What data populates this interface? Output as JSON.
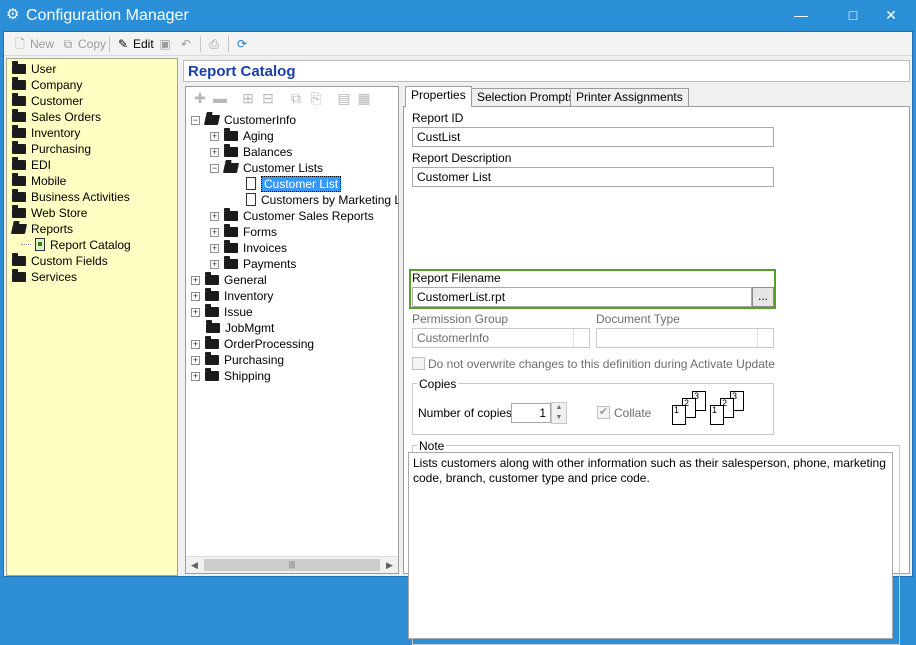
{
  "window": {
    "title": "Configuration Manager"
  },
  "toolbar": {
    "new": "New",
    "copy": "Copy",
    "edit": "Edit"
  },
  "nav": {
    "items": [
      "User",
      "Company",
      "Customer",
      "Sales Orders",
      "Inventory",
      "Purchasing",
      "EDI",
      "Mobile",
      "Business Activities",
      "Web Store",
      "Reports"
    ],
    "reports_child": "Report Catalog",
    "items_after": [
      "Custom Fields",
      "Services"
    ]
  },
  "catalog": {
    "title": "Report Catalog"
  },
  "tree": {
    "root": "CustomerInfo",
    "children": [
      "Aging",
      "Balances",
      "Customer Lists"
    ],
    "customer_lists_children": [
      "Customer List",
      "Customers by Marketing List"
    ],
    "more_children": [
      "Customer Sales Reports",
      "Forms",
      "Invoices",
      "Payments"
    ],
    "top_level": [
      "General",
      "Inventory",
      "Issue",
      "JobMgmt",
      "OrderProcessing",
      "Purchasing",
      "Shipping"
    ]
  },
  "tabs": [
    "Properties",
    "Selection Prompts",
    "Printer Assignments"
  ],
  "props": {
    "report_id_label": "Report ID",
    "report_id": "CustList",
    "report_desc_label": "Report Description",
    "report_desc": "Customer List",
    "report_filename_label": "Report Filename",
    "report_filename": "CustomerList.rpt",
    "browse": "...",
    "permission_label": "Permission Group",
    "permission_value": "CustomerInfo",
    "doctype_label": "Document Type",
    "overwrite_label": "Do not overwrite changes to this definition during Activate Update",
    "copies_group": "Copies",
    "num_copies_label": "Number of copies:",
    "num_copies": "1",
    "collate_label": "Collate",
    "note_group": "Note",
    "note_text": "Lists customers along with other information such as their salesperson, phone, marketing code, branch, customer type and price code."
  },
  "colors": {
    "titlebar": "#2b8fd8",
    "nav_bg": "#ffffc4",
    "catalog_title": "#1b3fa8",
    "highlight": "#5a9e2a",
    "selection": "#3399ff"
  }
}
